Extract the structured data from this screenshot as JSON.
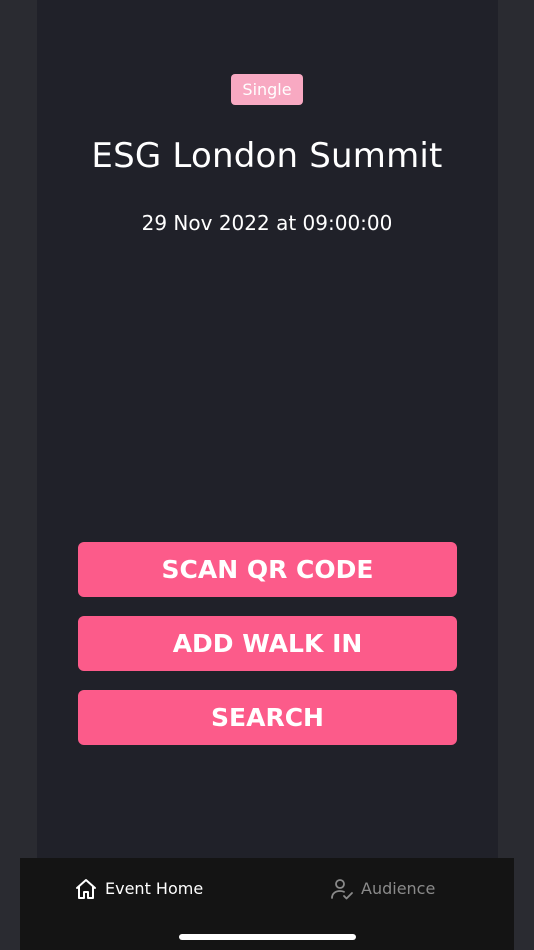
{
  "event": {
    "badge": "Single",
    "title": "ESG London Summit",
    "datetime": "29 Nov 2022 at 09:00:00"
  },
  "actions": {
    "scan": "SCAN QR CODE",
    "walk_in": "ADD WALK IN",
    "search": "SEARCH"
  },
  "tabs": [
    {
      "label": "Event Home",
      "icon": "home-icon",
      "active": true
    },
    {
      "label": "Audience",
      "icon": "user-check-icon",
      "active": false
    }
  ],
  "colors": {
    "background": "#2a2b31",
    "panel": "#202129",
    "accent": "#fc5b8a",
    "badge": "#f8a9c2",
    "tabbar": "#141414",
    "inactive_tab": "#8a8a8a"
  }
}
